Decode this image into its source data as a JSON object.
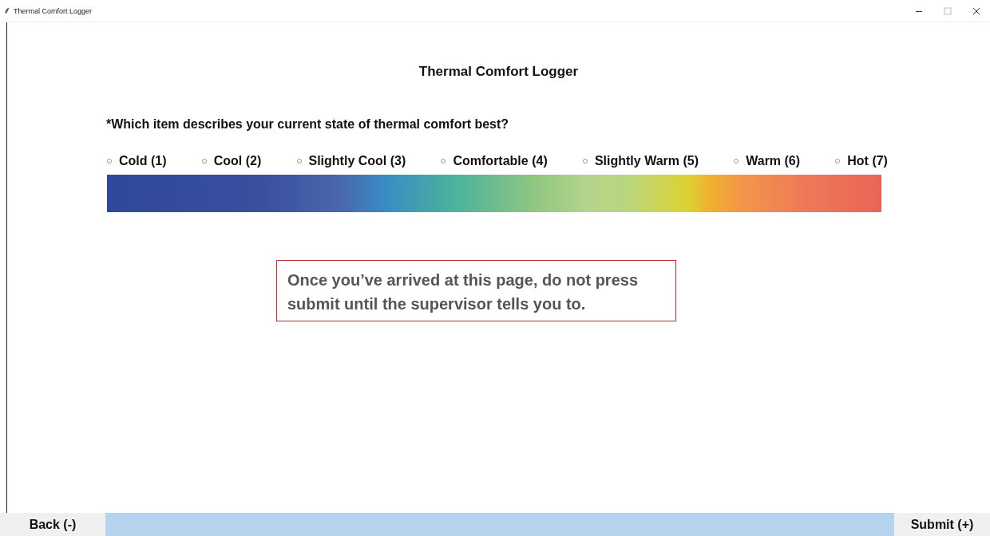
{
  "window": {
    "title": "Thermal Comfort Logger"
  },
  "heading": "Thermal Comfort Logger",
  "question": "*Which item describes your current state of thermal comfort best?",
  "options": [
    {
      "label": "Cold (1)",
      "selected": false
    },
    {
      "label": "Cool (2)",
      "selected": false
    },
    {
      "label": "Slightly Cool (3)",
      "selected": false
    },
    {
      "label": "Comfortable (4)",
      "selected": false
    },
    {
      "label": "Slightly Warm (5)",
      "selected": false
    },
    {
      "label": "Warm (6)",
      "selected": false
    },
    {
      "label": "Hot (7)",
      "selected": false
    }
  ],
  "note": "Once you’ve arrived at this page, do not press submit until the supervisor tells you to.",
  "buttons": {
    "back": "Back (-)",
    "submit": "Submit (+)"
  }
}
